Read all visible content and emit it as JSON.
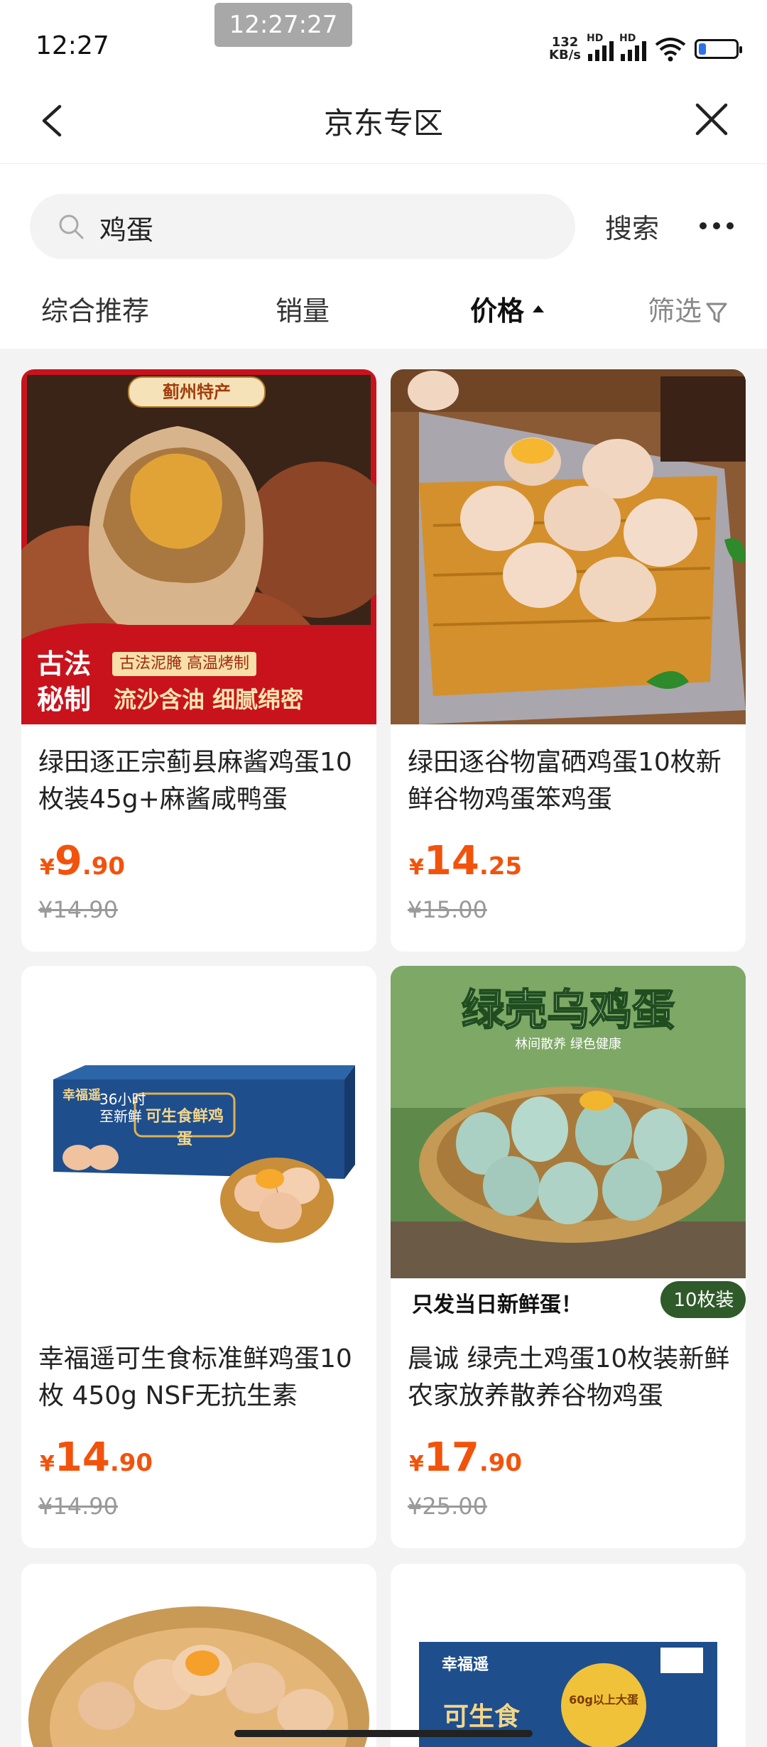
{
  "status_bar": {
    "time": "12:27",
    "time_overlay": "12:27:27",
    "net_speed": "132",
    "net_unit": "KB/s",
    "signal_label": "HD",
    "battery_percent": 20
  },
  "nav": {
    "title": "京东专区"
  },
  "search": {
    "value": "鸡蛋",
    "button_label": "搜索"
  },
  "sort": {
    "tabs": [
      {
        "label": "综合推荐"
      },
      {
        "label": "销量"
      },
      {
        "label": "价格"
      },
      {
        "label": "筛选"
      }
    ]
  },
  "products": [
    {
      "title": "绿田逐正宗蓟县麻酱鸡蛋10枚装45g+麻酱咸鸭蛋",
      "currency": "¥",
      "price_int": "9",
      "price_dec": ".90",
      "original_price": "¥14.90",
      "image_texts": {
        "top_badge": "蓟州特产",
        "left_badge_1": "古法",
        "left_badge_2": "秘制",
        "small_line": "古法泥腌 高温烤制",
        "big_line": "流沙含油 细腻绵密"
      }
    },
    {
      "title": "绿田逐谷物富硒鸡蛋10枚新鲜谷物鸡蛋笨鸡蛋",
      "currency": "¥",
      "price_int": "14",
      "price_dec": ".25",
      "original_price": "¥15.00"
    },
    {
      "title": "幸福遥可生食标准鲜鸡蛋10枚 450g NSF无抗生素",
      "currency": "¥",
      "price_int": "14",
      "price_dec": ".90",
      "original_price": "¥14.90",
      "image_texts": {
        "brand": "幸福遥",
        "hours": "36小时",
        "fresh": "至新鲜",
        "box_title": "可生食鲜鸡蛋"
      }
    },
    {
      "title": "晨诚 绿壳土鸡蛋10枚装新鲜农家放养散养谷物鸡蛋",
      "currency": "¥",
      "price_int": "17",
      "price_dec": ".90",
      "original_price": "¥25.00",
      "image_texts": {
        "headline": "绿壳乌鸡蛋",
        "sub": "林间散养 绿色健康",
        "footer": "只发当日新鲜蛋！",
        "tag": "10枚装"
      }
    }
  ],
  "partial_products": [
    {
      "image_texts": {}
    },
    {
      "image_texts": {
        "brand": "幸福遥",
        "box_title": "可生食",
        "seal": "60g以上大蛋"
      }
    }
  ]
}
